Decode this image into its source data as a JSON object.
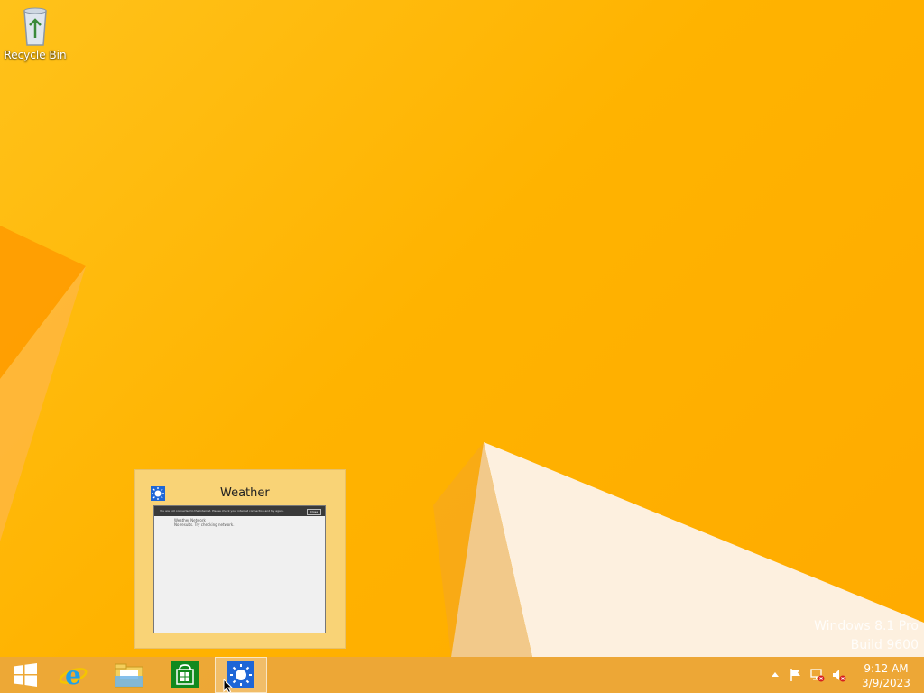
{
  "desktop": {
    "recycle_bin_label": "Recycle Bin"
  },
  "watermark": {
    "line1": "Windows 8.1 Pro",
    "line2": "Build 9600"
  },
  "thumbnail": {
    "title": "Weather",
    "preview_bar_text": "You are not connected to the Internet. Please check your internet connection and try again.",
    "preview_button_label": "Close",
    "preview_heading": "Weather Network",
    "preview_subtext": "No results. Try checking network."
  },
  "taskbar": {
    "start_icon": "windows-logo-icon",
    "pinned": [
      "internet-explorer-icon",
      "file-explorer-icon",
      "store-icon",
      "weather-icon"
    ],
    "active_app": "Weather"
  },
  "tray": {
    "time": "9:12 AM",
    "date": "3/9/2023",
    "icons": [
      "show-hidden-icons-icon",
      "action-center-flag-icon",
      "network-error-icon",
      "volume-muted-icon"
    ]
  },
  "colors": {
    "wallpaper": "#ffb300",
    "accent": "#1e66d6",
    "taskbar": "#eba63c"
  }
}
